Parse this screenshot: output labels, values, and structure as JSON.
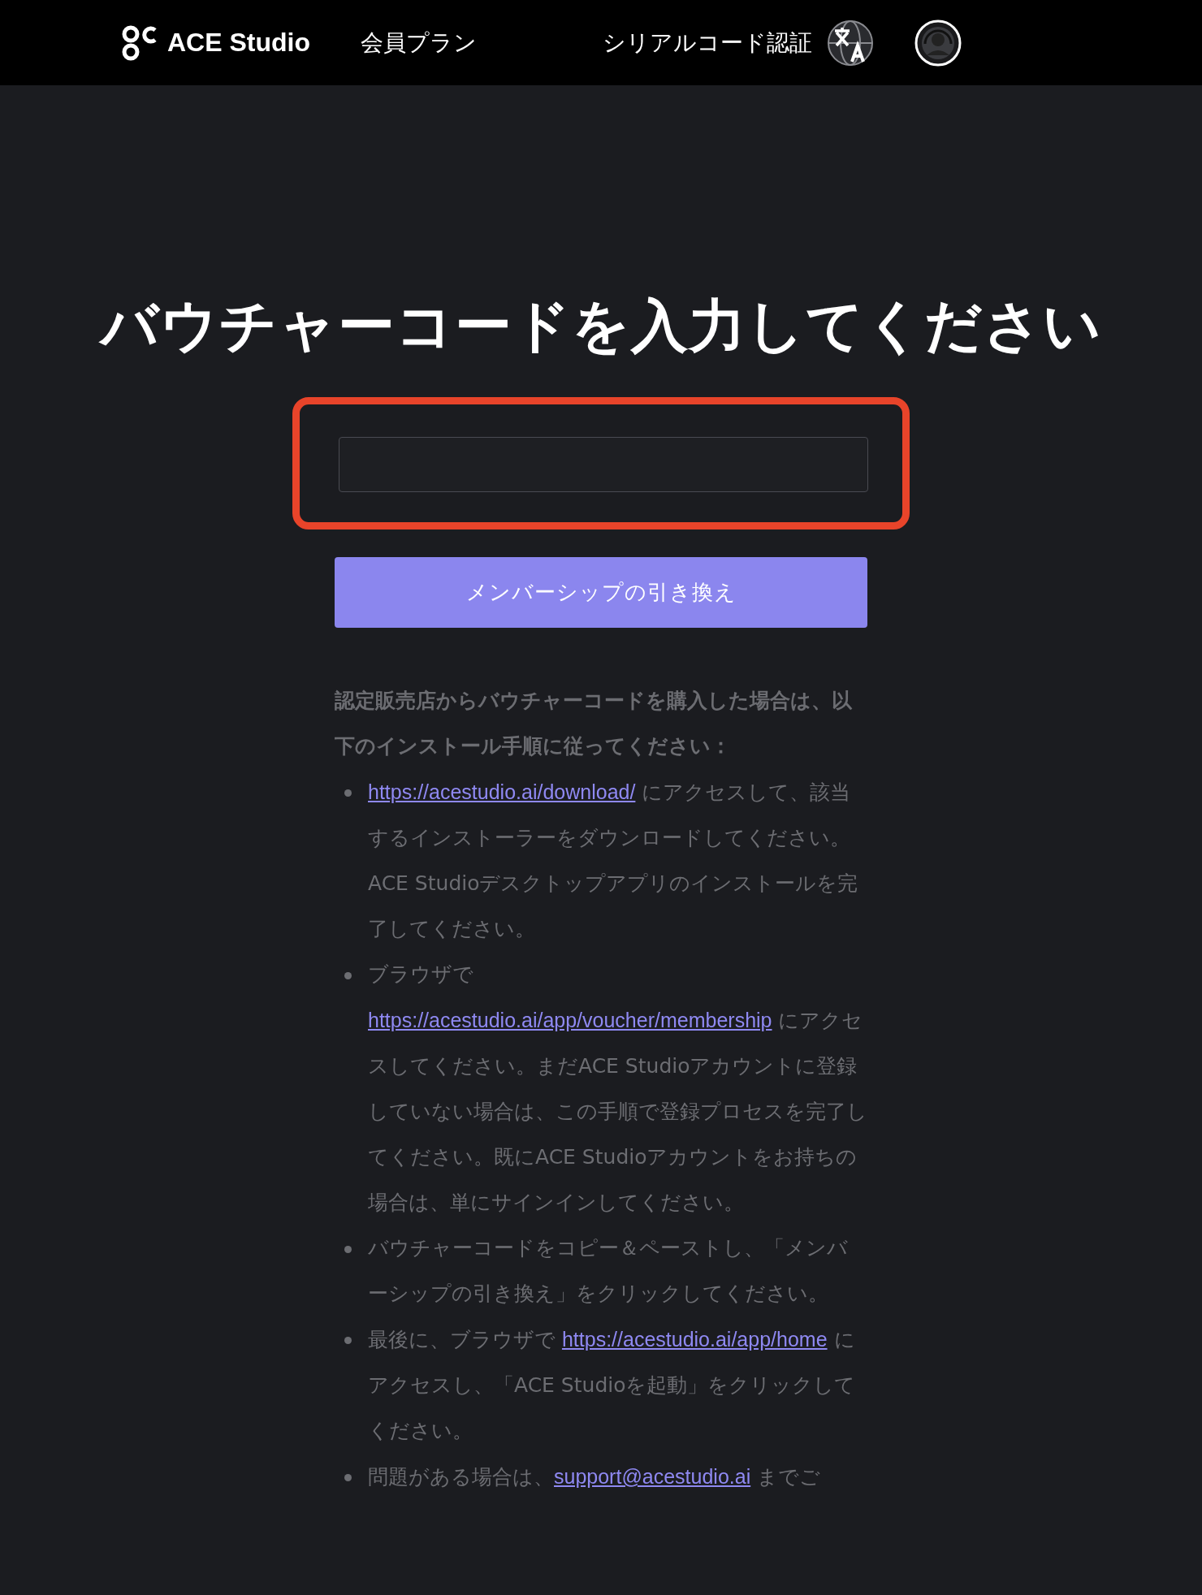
{
  "header": {
    "brand": "ACE Studio",
    "nav": [
      {
        "label": "会員プラン"
      }
    ],
    "serial_link": "シリアルコード認証"
  },
  "title": "バウチャーコードを入力してください",
  "voucher_input": {
    "highlighted": true
  },
  "redeem_button": "メンバーシップの引き換え",
  "instructions": {
    "heading": "認定販売店からバウチャーコードを購入した場合は、以下のインストール手順に従ってください：",
    "steps": [
      [
        {
          "kind": "link",
          "text": "https://acestudio.ai/download/"
        },
        {
          "kind": "text",
          "text": " にアクセスして、該当するインストーラーをダウンロードしてください。ACE Studioデスクトップアプリのインストールを完了してください。"
        }
      ],
      [
        {
          "kind": "text",
          "text": "ブラウザで "
        },
        {
          "kind": "link",
          "text": "https://acestudio.ai/app/voucher/membership"
        },
        {
          "kind": "text",
          "text": " にアクセスしてください。まだACE Studioアカウントに登録していない場合は、この手順で登録プロセスを完了してください。既にACE Studioアカウントをお持ちの場合は、単にサインインしてください。"
        }
      ],
      [
        {
          "kind": "text",
          "text": "バウチャーコードをコピー＆ペーストし、「メンバーシップの引き換え」をクリックしてください。"
        }
      ],
      [
        {
          "kind": "text",
          "text": "最後に、ブラウザで "
        },
        {
          "kind": "link",
          "text": "https://acestudio.ai/app/home"
        },
        {
          "kind": "text",
          "text": " にアクセスし、「ACE Studioを起動」をクリックしてください。"
        }
      ],
      [
        {
          "kind": "text",
          "text": "問題がある場合は、"
        },
        {
          "kind": "link",
          "text": "support@acestudio.ai"
        },
        {
          "kind": "text",
          "text": " までご"
        }
      ]
    ]
  }
}
